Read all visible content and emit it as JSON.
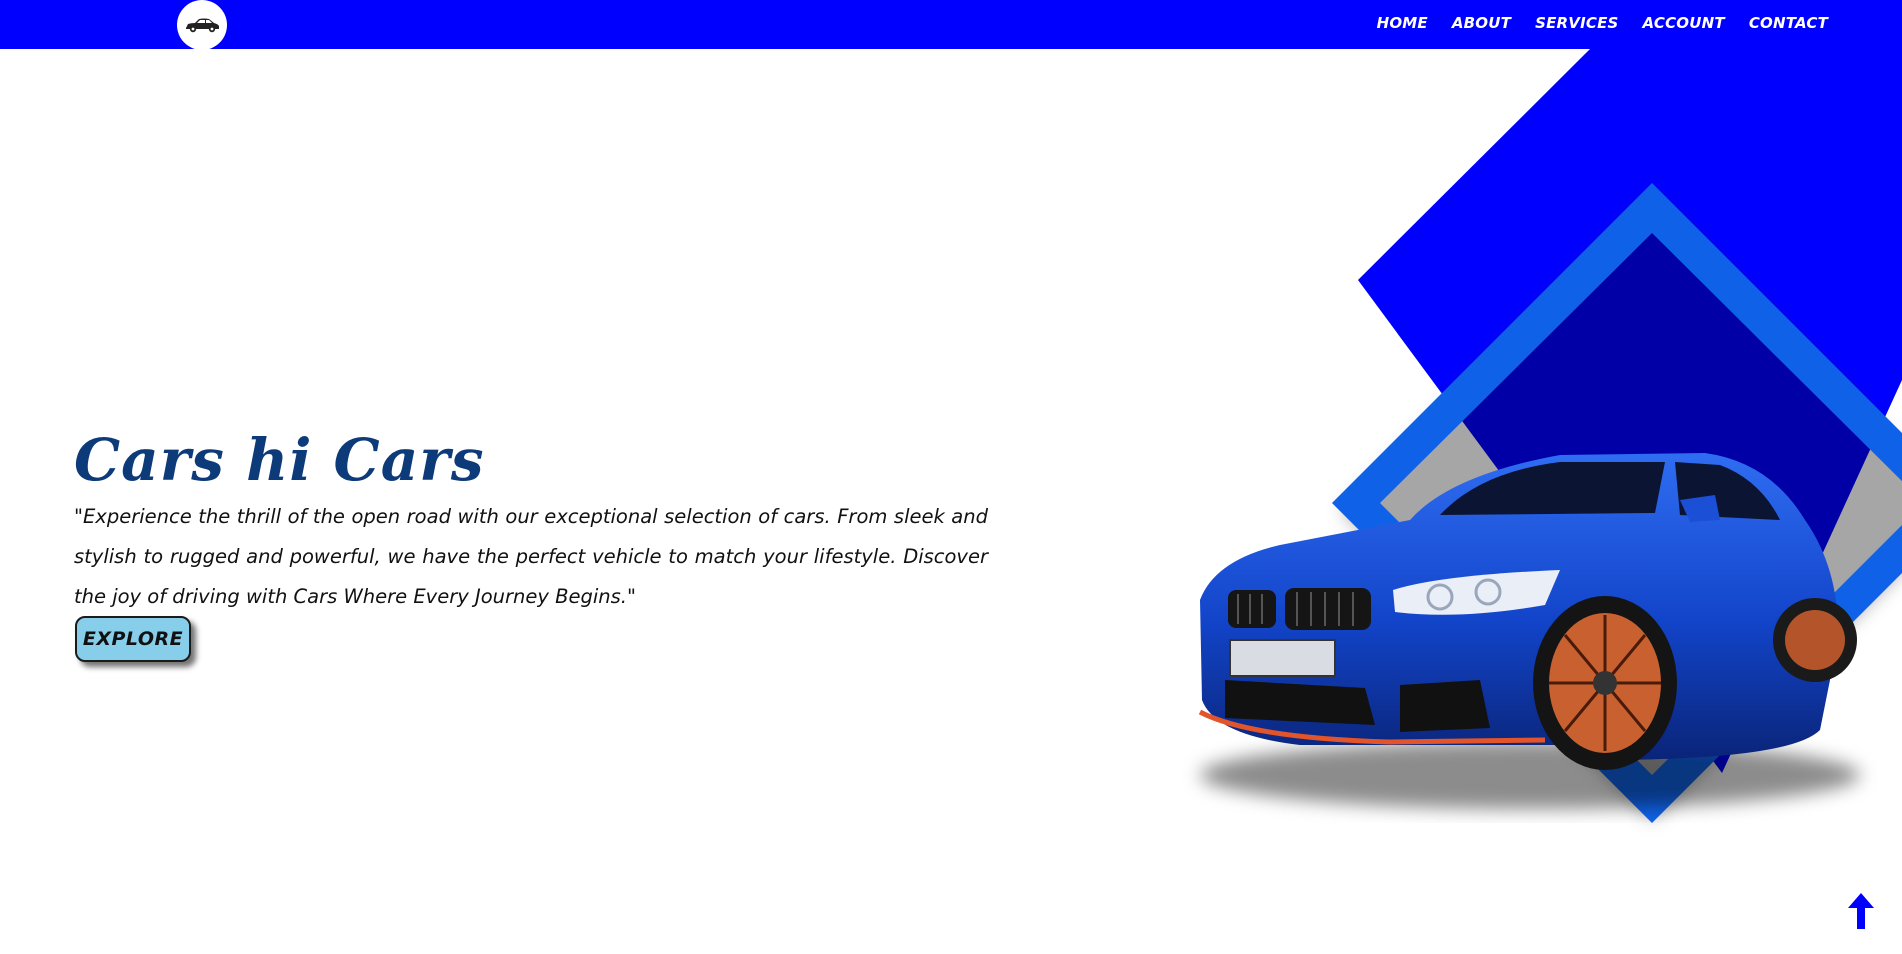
{
  "colors": {
    "accent": "#0000ff",
    "secondary_blue": "#0f62e8",
    "title": "#0d3b7a",
    "button_bg": "#87ceeb"
  },
  "navbar": {
    "logo_icon": "car-icon",
    "links": [
      {
        "label": "HOME"
      },
      {
        "label": "ABOUT"
      },
      {
        "label": "SERVICES"
      },
      {
        "label": "ACCOUNT"
      },
      {
        "label": "CONTACT"
      }
    ]
  },
  "hero": {
    "title": "Cars hi Cars",
    "description": "\"Experience the thrill of the open road with our exceptional selection of cars. From sleek and stylish to rugged and powerful, we have the perfect vehicle to match your lifestyle. Discover the joy of driving with Cars Where Every Journey Begins.\"",
    "button_label": "EXPLORE",
    "image_icon": "blue-sports-car-image"
  },
  "scroll_top": {
    "icon": "arrow-up-icon"
  }
}
